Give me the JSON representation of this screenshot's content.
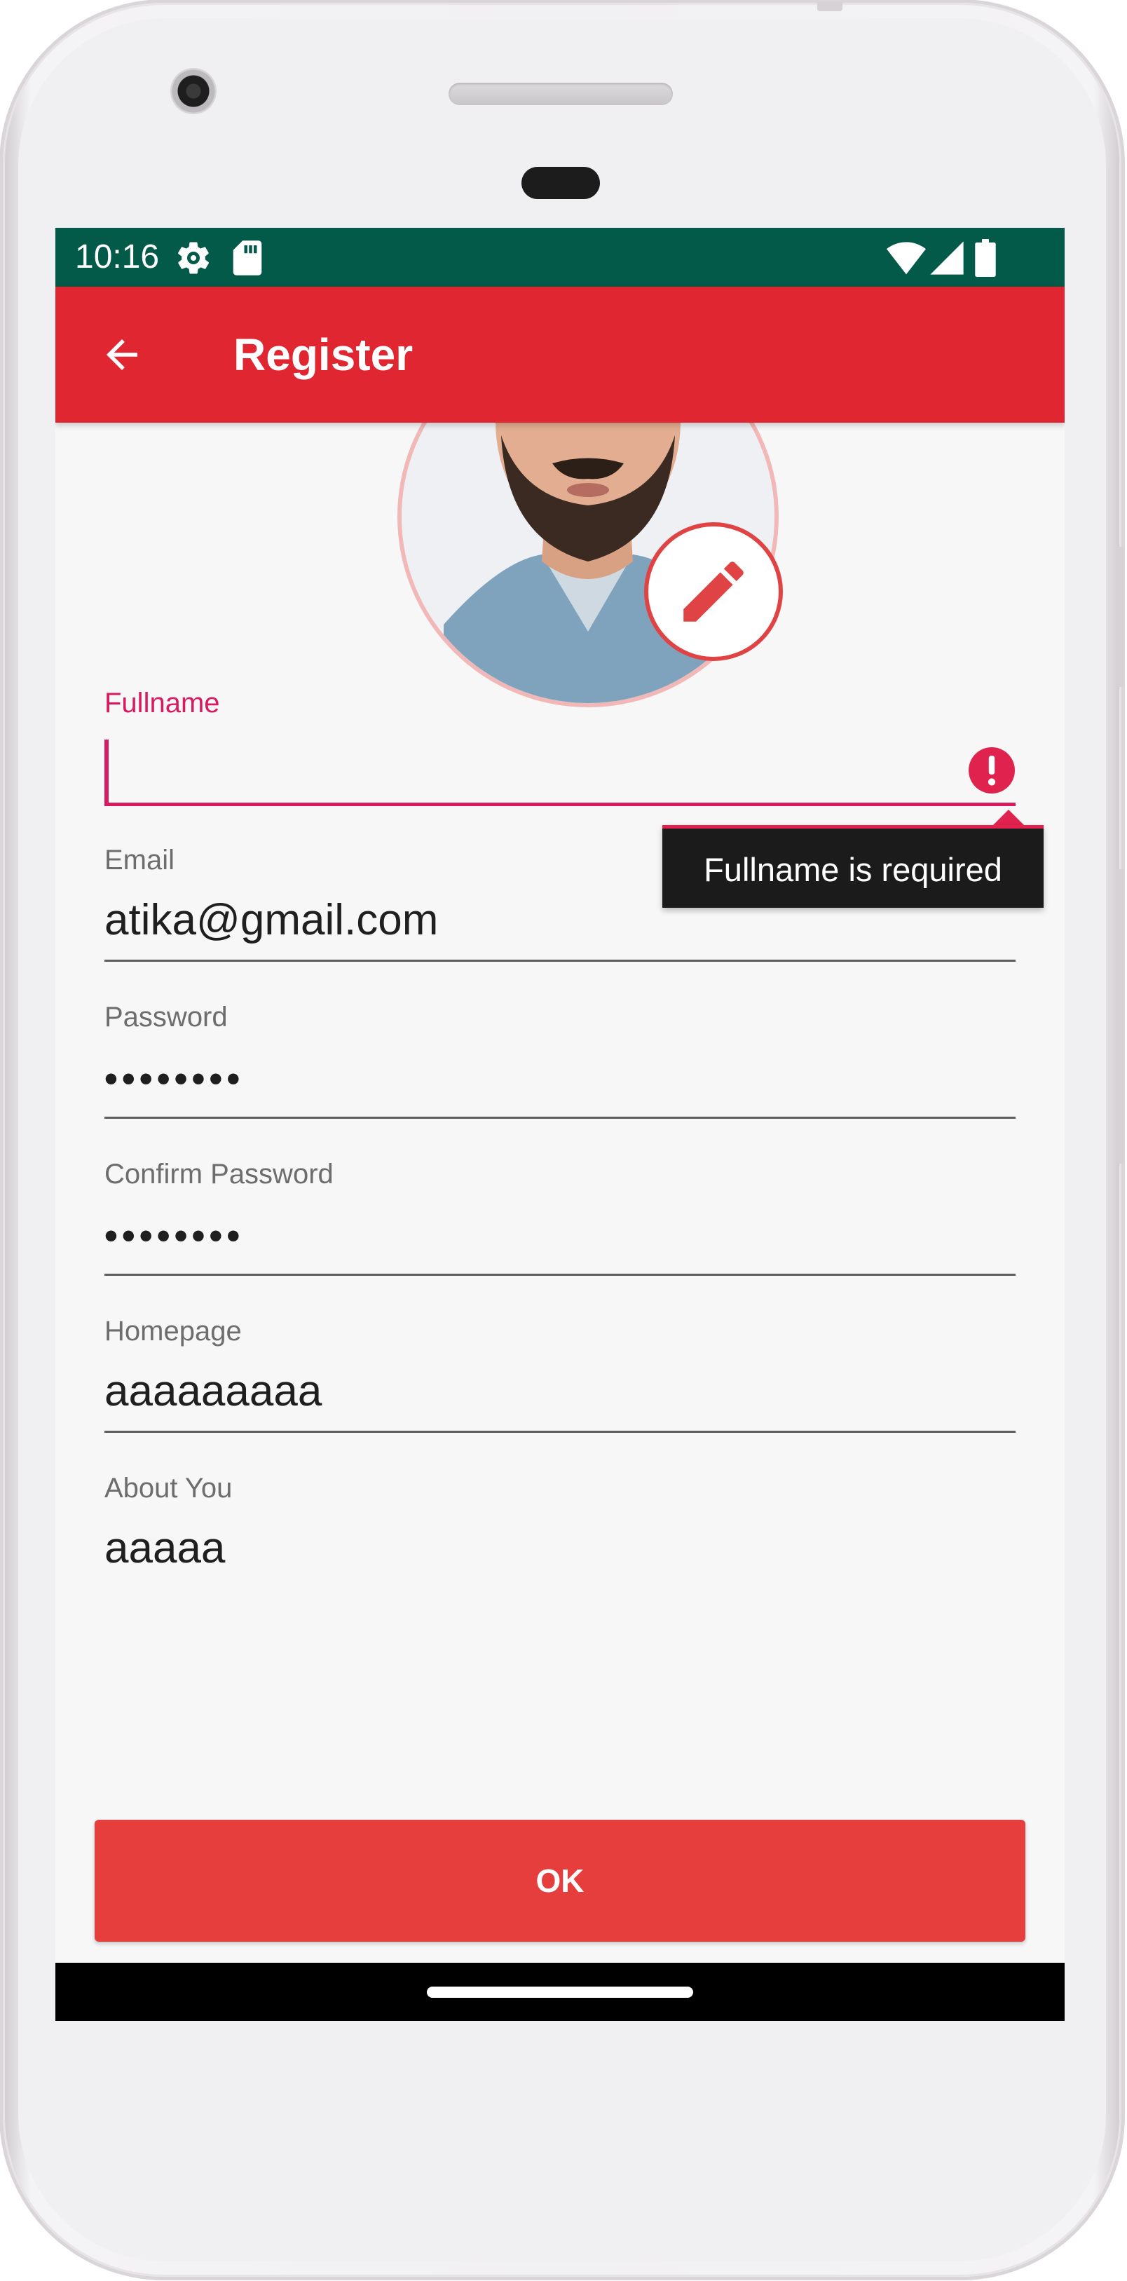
{
  "status_bar": {
    "time": "10:16",
    "icons": [
      "settings-icon",
      "sd-card-icon",
      "wifi-icon",
      "cell-signal-icon",
      "battery-icon"
    ],
    "background": "#045a48"
  },
  "app_bar": {
    "title": "Register",
    "back_icon": "back-arrow-icon",
    "background": "#e02630"
  },
  "avatar": {
    "edit_icon": "pencil-icon",
    "accent": "#e04343"
  },
  "form": {
    "fullname": {
      "label": "Fullname",
      "value": "",
      "error": "Fullname is required"
    },
    "email": {
      "label": "Email",
      "value": "atika@gmail.com"
    },
    "password": {
      "label": "Password",
      "value": "••••••••"
    },
    "confirm_password": {
      "label": "Confirm Password",
      "value": "••••••••"
    },
    "homepage": {
      "label": "Homepage",
      "value": "aaaaaaaaa"
    },
    "about": {
      "label": "About You",
      "value": "aaaaa"
    }
  },
  "ok_button": {
    "label": "OK",
    "color": "#e63d3d"
  },
  "colors": {
    "error": "#d81b60"
  }
}
